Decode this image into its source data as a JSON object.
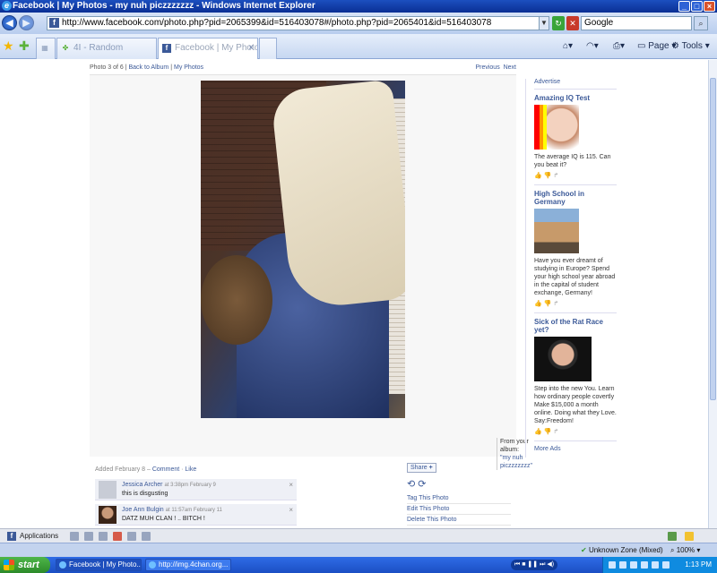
{
  "window": {
    "title": "Facebook | My Photos - my nuh piczzzzzzz - Windows Internet Explorer"
  },
  "address": {
    "url": "http://www.facebook.com/photo.php?pid=2065399&id=516403078#/photo.php?pid=2065401&id=516403078",
    "search_placeholder": "Google"
  },
  "tabs": [
    {
      "label": "4Ⅰ - Random",
      "active": false
    },
    {
      "label": "Facebook | My Photo...",
      "active": true
    }
  ],
  "commands": {
    "page": "Page",
    "tools": "Tools"
  },
  "photo_nav": {
    "counter": "Photo 3 of 6",
    "back_to_album": "Back to Album",
    "my_photos": "My Photos",
    "separator": "|",
    "previous": "Previous",
    "next": "Next"
  },
  "album": {
    "from_label": "From your album:",
    "name": "\"my nuh piczzzzzzz\""
  },
  "sidebar": {
    "advertise": "Advertise",
    "ads": [
      {
        "title": "Amazing IQ Test",
        "text": "The average IQ is 115. Can you beat it?"
      },
      {
        "title": "High School in Germany",
        "text": "Have you ever dreamt of studying in Europe? Spend your high school year abroad in the capital of student exchange, Germany!"
      },
      {
        "title": "Sick of the Rat Race yet?",
        "text": "Step into the new You. Learn how ordinary people covertly Make $15,000 a month online. Doing what they Love. Say:Freedom!"
      }
    ],
    "more_ads": "More Ads"
  },
  "meta": {
    "added": "Added February 8 –",
    "comment": "Comment",
    "like": "Like"
  },
  "comments": [
    {
      "author": "Jessica Archer",
      "time": "at 3:38pm February 9",
      "text": "this is disgusting"
    },
    {
      "author": "Joe Ann Bulgin",
      "time": "at 11:57am February 11",
      "text": "DATZ MUH CLAN ! .. BITCH !"
    }
  ],
  "actions": {
    "share": "Share",
    "tag": "Tag This Photo",
    "edit": "Edit This Photo",
    "delete": "Delete This Photo"
  },
  "fb_bar": {
    "applications": "Applications"
  },
  "status": {
    "zone": "Unknown Zone (Mixed)",
    "zoom": "100%"
  },
  "taskbar": {
    "start": "start",
    "tasks": [
      {
        "label": "Facebook | My Photo...",
        "active": true
      },
      {
        "label": "http://img.4chan.org...",
        "active": false
      }
    ],
    "clock": "1:13 PM"
  },
  "colors": {
    "facebook_blue": "#3b5998",
    "xp_blue": "#1b4fc4"
  }
}
